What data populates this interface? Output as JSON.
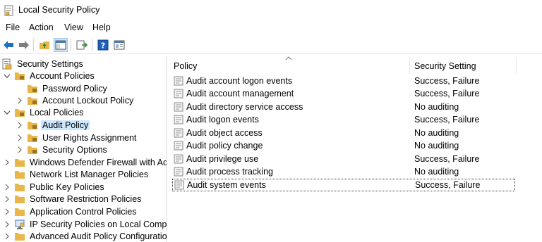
{
  "window": {
    "title": "Local Security Policy"
  },
  "menu": [
    "File",
    "Action",
    "View",
    "Help"
  ],
  "toolbar": {
    "buttons": [
      "back-icon",
      "forward-icon",
      "up-folder-icon",
      "show-hide-tree-icon",
      "export-list-icon",
      "help-icon",
      "properties-icon"
    ]
  },
  "tree": {
    "root": "Security Settings",
    "items": [
      {
        "label": "Account Policies"
      },
      {
        "label": "Password Policy"
      },
      {
        "label": "Account Lockout Policy"
      },
      {
        "label": "Local Policies"
      },
      {
        "label": "Audit Policy"
      },
      {
        "label": "User Rights Assignment"
      },
      {
        "label": "Security Options"
      },
      {
        "label": "Windows Defender Firewall with Adva"
      },
      {
        "label": "Network List Manager Policies"
      },
      {
        "label": "Public Key Policies"
      },
      {
        "label": "Software Restriction Policies"
      },
      {
        "label": "Application Control Policies"
      },
      {
        "label": "IP Security Policies on Local Compute"
      },
      {
        "label": "Advanced Audit Policy Configuration"
      }
    ]
  },
  "list": {
    "columns": [
      "Policy",
      "Security Setting"
    ],
    "rows": [
      {
        "policy": "Audit account logon events",
        "setting": "Success, Failure"
      },
      {
        "policy": "Audit account management",
        "setting": "Success, Failure"
      },
      {
        "policy": "Audit directory service access",
        "setting": "No auditing"
      },
      {
        "policy": "Audit logon events",
        "setting": "Success, Failure"
      },
      {
        "policy": "Audit object access",
        "setting": "No auditing"
      },
      {
        "policy": "Audit policy change",
        "setting": "No auditing"
      },
      {
        "policy": "Audit privilege use",
        "setting": "Success, Failure"
      },
      {
        "policy": "Audit process tracking",
        "setting": "No auditing"
      },
      {
        "policy": "Audit system events",
        "setting": "Success, Failure"
      }
    ]
  },
  "colors": {
    "selection": "#cce8ff",
    "folder": "#e8b64a",
    "accent": "#1e73be"
  }
}
